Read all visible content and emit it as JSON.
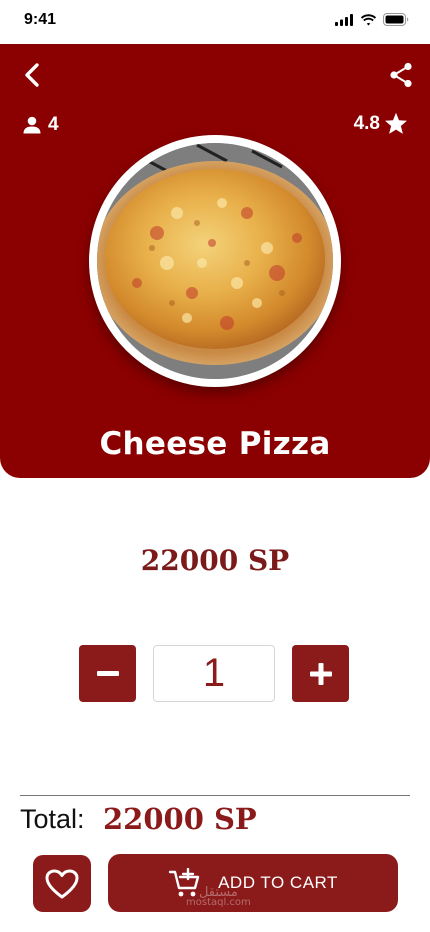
{
  "status_bar": {
    "time": "9:41"
  },
  "header": {
    "servings": "4",
    "rating": "4.8"
  },
  "product": {
    "name": "Cheese Pizza",
    "price": "22000 SP"
  },
  "quantity": {
    "value": "1",
    "decrement_symbol": "−",
    "increment_symbol": "+"
  },
  "total": {
    "label": "Total:",
    "value": "22000 SP"
  },
  "actions": {
    "add_to_cart_label": "ADD TO CART"
  },
  "watermark": {
    "arabic": "مستقل",
    "latin": "mostaql.com"
  },
  "colors": {
    "brand": "#8b0000",
    "button": "#8b1a1a",
    "price": "#7a1a1a"
  },
  "icons": [
    "back-chevron-icon",
    "share-icon",
    "person-icon",
    "star-icon",
    "minus-icon",
    "plus-icon",
    "heart-icon",
    "cart-add-icon",
    "signal-icon",
    "wifi-icon",
    "battery-icon"
  ]
}
